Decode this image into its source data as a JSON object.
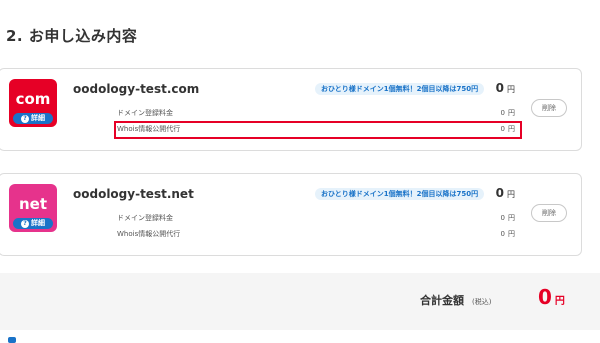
{
  "section": {
    "title": "2. お申し込み内容"
  },
  "items": [
    {
      "tld": "com",
      "tld_color": "#e60026",
      "detail_label": "詳細",
      "domain": "oodology-test.com",
      "promo": "おひとり様ドメイン1個無料！2個目以降は750円",
      "price": "0",
      "currency": "円",
      "lines": [
        {
          "label": "ドメイン登録料金",
          "amount": "0",
          "currency": "円"
        },
        {
          "label": "Whois情報公開代行",
          "amount": "0",
          "currency": "円"
        }
      ],
      "delete_label": "削除"
    },
    {
      "tld": "net",
      "tld_color": "#e6338c",
      "detail_label": "詳細",
      "domain": "oodology-test.net",
      "promo": "おひとり様ドメイン1個無料！2個目以降は750円",
      "price": "0",
      "currency": "円",
      "lines": [
        {
          "label": "ドメイン登録料金",
          "amount": "0",
          "currency": "円"
        },
        {
          "label": "Whois情報公開代行",
          "amount": "0",
          "currency": "円"
        }
      ],
      "delete_label": "削除"
    }
  ],
  "total": {
    "label": "合計金額",
    "tax_note": "(税込)",
    "amount": "0",
    "currency": "円",
    "color": "#e60026"
  }
}
